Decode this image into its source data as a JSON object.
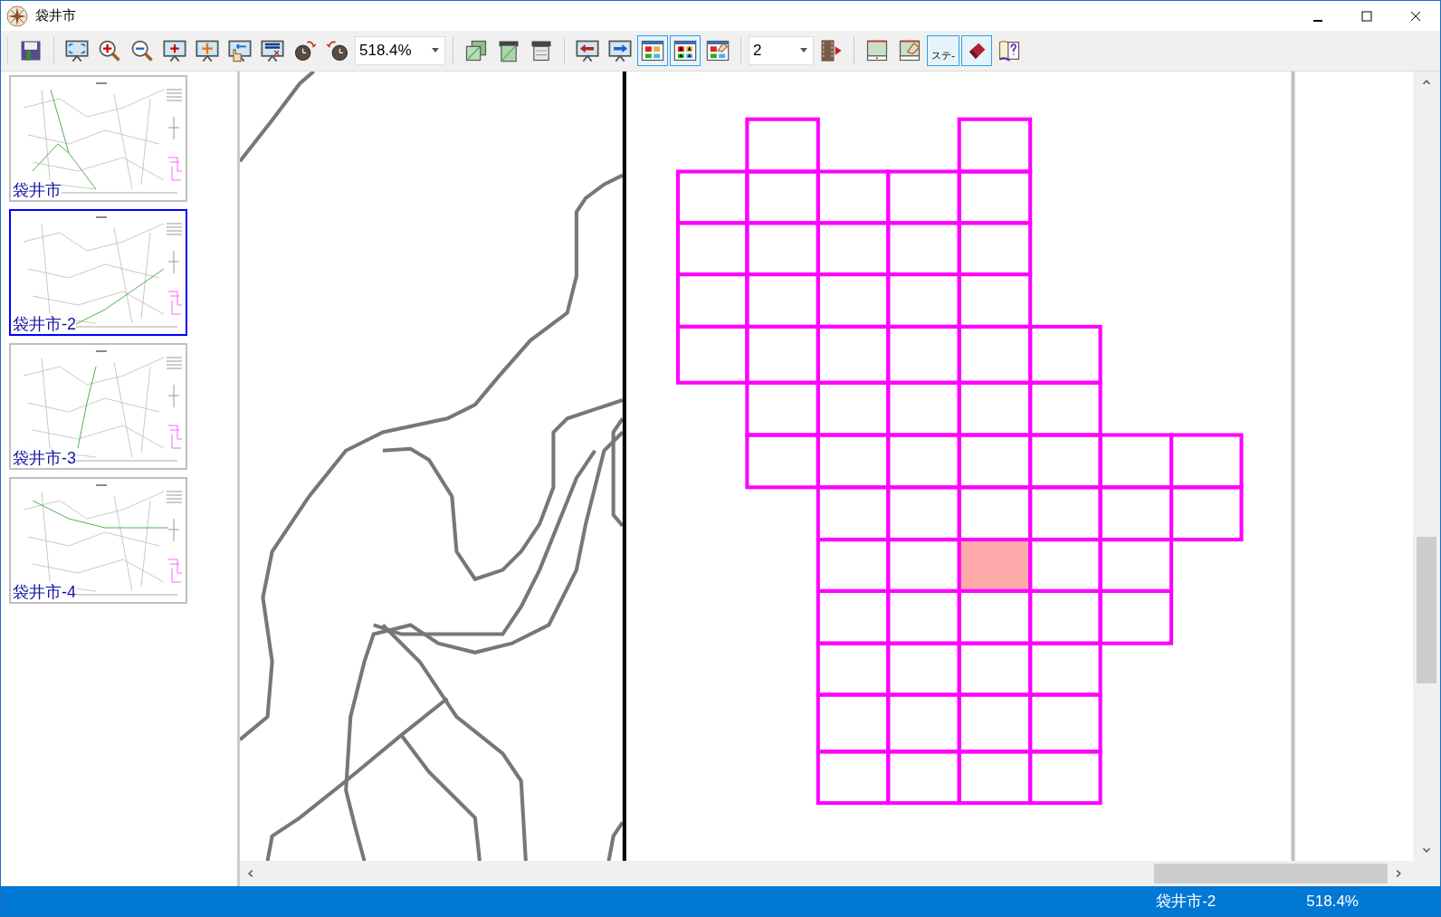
{
  "window": {
    "title": "袋井市"
  },
  "toolbar": [
    {
      "kind": "button",
      "selected": false
    },
    {
      "kind": "separator"
    },
    {
      "kind": "button",
      "selected": false
    },
    {
      "kind": "button",
      "selected": false
    },
    {
      "kind": "button",
      "selected": false
    },
    {
      "kind": "button",
      "selected": false
    },
    {
      "kind": "button",
      "selected": false
    },
    {
      "kind": "button",
      "selected": false
    },
    {
      "kind": "button",
      "selected": false
    },
    {
      "kind": "button",
      "selected": false
    },
    {
      "kind": "button",
      "selected": false
    },
    {
      "kind": "combo",
      "value": "518.4%"
    },
    {
      "kind": "separator"
    },
    {
      "kind": "button",
      "selected": false
    },
    {
      "kind": "button",
      "selected": false
    },
    {
      "kind": "button",
      "selected": false
    },
    {
      "kind": "separator"
    },
    {
      "kind": "button",
      "selected": false
    },
    {
      "kind": "button",
      "selected": false
    },
    {
      "kind": "button",
      "selected": true
    },
    {
      "kind": "button",
      "selected": true
    },
    {
      "kind": "button",
      "selected": false
    },
    {
      "kind": "separator"
    },
    {
      "kind": "combo",
      "value": "2"
    },
    {
      "kind": "button",
      "selected": false
    },
    {
      "kind": "separator"
    },
    {
      "kind": "button",
      "selected": false
    },
    {
      "kind": "button",
      "selected": false
    },
    {
      "kind": "button",
      "selected": true,
      "label": "ステ-"
    },
    {
      "kind": "button",
      "selected": true
    },
    {
      "kind": "button",
      "selected": false
    }
  ],
  "sidebar": {
    "pages": [
      {
        "label": "袋井市",
        "selected": false
      },
      {
        "label": "袋井市-2",
        "selected": true
      },
      {
        "label": "袋井市-3",
        "selected": false
      },
      {
        "label": "袋井市-4",
        "selected": false
      }
    ]
  },
  "status_bar": {
    "page": "袋井市-2",
    "zoom": "518.4%"
  }
}
